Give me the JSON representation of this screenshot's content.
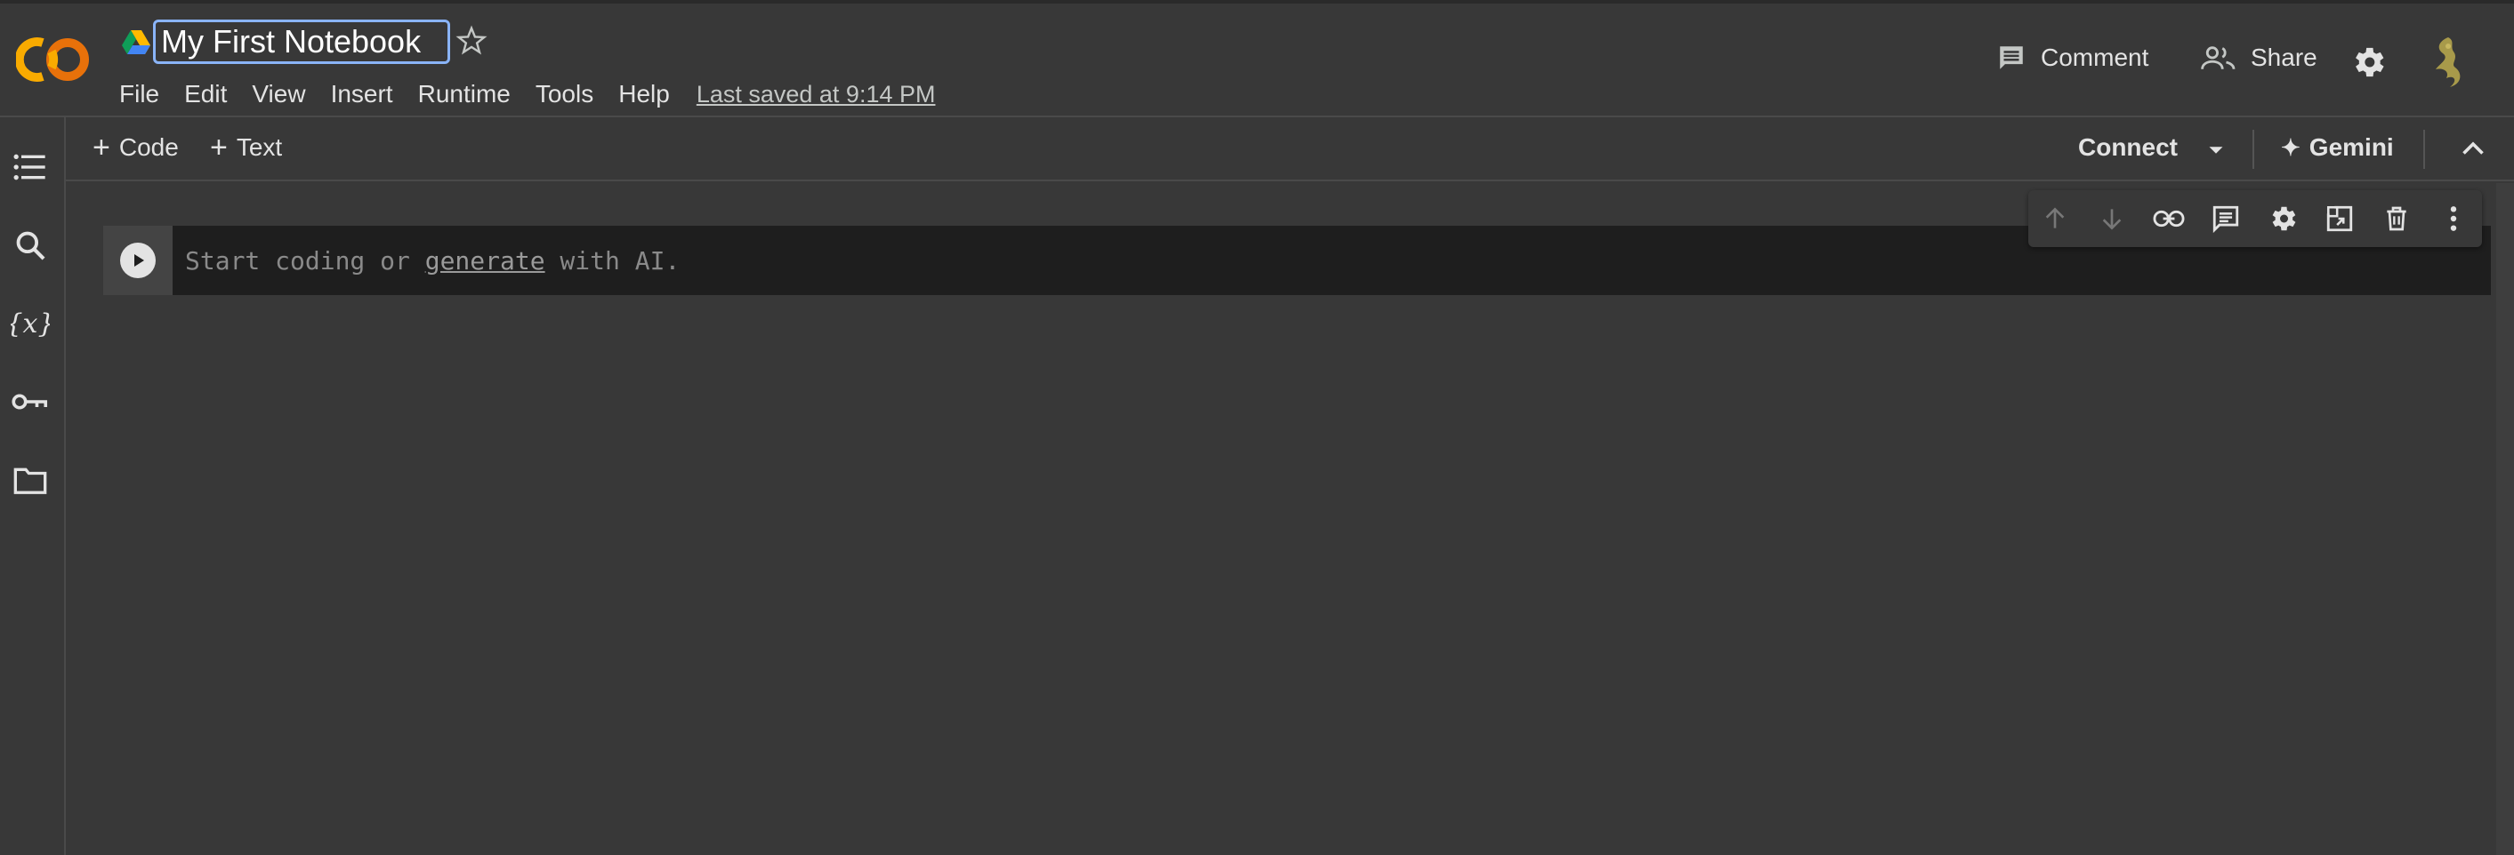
{
  "header": {
    "notebook_title": "My First Notebook",
    "menu": [
      "File",
      "Edit",
      "View",
      "Insert",
      "Runtime",
      "Tools",
      "Help"
    ],
    "last_saved": "Last saved at 9:14 PM",
    "comment_label": "Comment",
    "share_label": "Share"
  },
  "sidebar": {
    "icons": [
      "table-of-contents-icon",
      "search-icon",
      "variables-icon",
      "secrets-key-icon",
      "files-folder-icon"
    ]
  },
  "toolbar": {
    "add_code_label": "Code",
    "add_text_label": "Text",
    "connect_label": "Connect",
    "gemini_label": "Gemini"
  },
  "cell": {
    "placeholder_start": "Start coding or ",
    "placeholder_link": "generate",
    "placeholder_end": " with AI."
  },
  "colors": {
    "background": "#383838",
    "cell_background": "#1e1e1e",
    "title_focus": "#8ab4f8",
    "logo_orange": "#f9ab00",
    "logo_dark_orange": "#e8710a"
  }
}
